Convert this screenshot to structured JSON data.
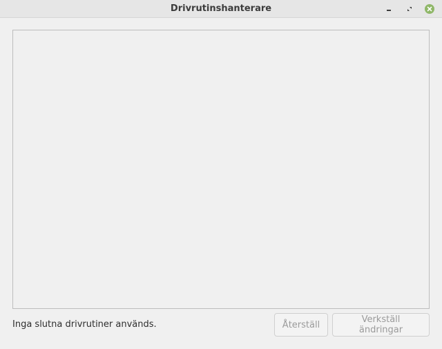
{
  "window": {
    "title": "Drivrutinshanterare"
  },
  "icons": {
    "minimize": "minimize-icon",
    "restore": "restore-icon",
    "close": "close-icon",
    "close_color": "#8fb768"
  },
  "status": {
    "text": "Inga slutna drivrutiner används."
  },
  "buttons": {
    "reset_label": "Återställ",
    "apply_label": "Verkställ ändringar"
  }
}
